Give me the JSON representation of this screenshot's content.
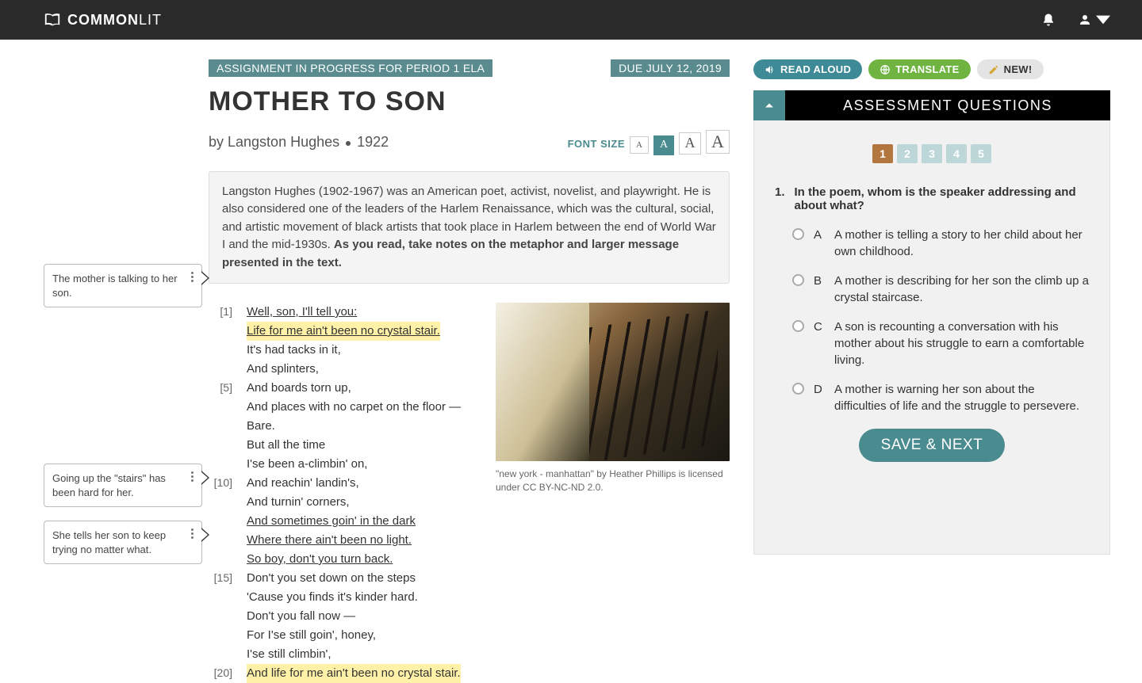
{
  "brand": {
    "strong": "COMMON",
    "light": "LIT"
  },
  "header": {
    "assignment_badge": "ASSIGNMENT IN PROGRESS FOR PERIOD 1 ELA",
    "due_badge": "DUE JULY 12, 2019",
    "title": "MOTHER TO SON",
    "author_prefix": "by ",
    "author": "Langston Hughes",
    "year": "1922",
    "fontsize_label": "FONT SIZE"
  },
  "intro": {
    "body": "Langston Hughes (1902-1967) was an American poet, activist, novelist, and playwright. He is also considered one of the leaders of the Harlem Renaissance, which was the cultural, social, and artistic movement of black artists that took place in Harlem between the end of World War I and the mid-1930s. ",
    "bold": "As you read, take notes on the metaphor and larger message presented in the text."
  },
  "notes": [
    "The mother is talking to her son.",
    "Going up the \"stairs\" has been hard for her.",
    "She tells her son to keep trying no matter what."
  ],
  "line_numbers": {
    "l1": "[1]",
    "l5": "[5]",
    "l10": "[10]",
    "l15": "[15]",
    "l20": "[20]"
  },
  "poem": {
    "l1": "Well, son, I'll tell you:",
    "l2": "Life for me ain't been no crystal stair.",
    "l3": "It's had tacks in it,",
    "l4": "And splinters,",
    "l5": "And boards torn up,",
    "l6": "And places with no carpet on the floor —",
    "l7": "Bare.",
    "l8": "But all the time",
    "l9": "I'se been a-climbin' on,",
    "l10": "And reachin' landin's,",
    "l11": "And turnin' corners,",
    "l12": "And sometimes goin' in the dark",
    "l13": "Where there ain't been no light.",
    "l14": "So boy, don't you turn back.",
    "l15": "Don't you set down on the steps",
    "l16": "'Cause you finds it's kinder hard.",
    "l17": "Don't you fall now —",
    "l18": "For I'se still goin', honey,",
    "l19": "I'se still climbin',",
    "l20": "And life for me ain't been no crystal stair."
  },
  "caption": "\"new york - manhattan\" by Heather Phillips is licensed under CC BY-NC-ND 2.0.",
  "tools": {
    "read_aloud": "READ ALOUD",
    "translate": "TRANSLATE",
    "new": "NEW!"
  },
  "panel": {
    "title": "ASSESSMENT QUESTIONS",
    "questions_nav": [
      "1",
      "2",
      "3",
      "4",
      "5"
    ],
    "question_number": "1.",
    "question_text": "In the poem, whom is the speaker addressing and about what?",
    "choices": [
      {
        "letter": "A",
        "text": "A mother is telling a story to her child about her own childhood."
      },
      {
        "letter": "B",
        "text": "A mother is describing for her son the climb up a crystal staircase."
      },
      {
        "letter": "C",
        "text": "A son is recounting a conversation with his mother about his struggle to earn a comfortable living."
      },
      {
        "letter": "D",
        "text": "A mother is warning her son about the difficulties of life and the struggle to persevere."
      }
    ],
    "save_label": "SAVE & NEXT"
  }
}
